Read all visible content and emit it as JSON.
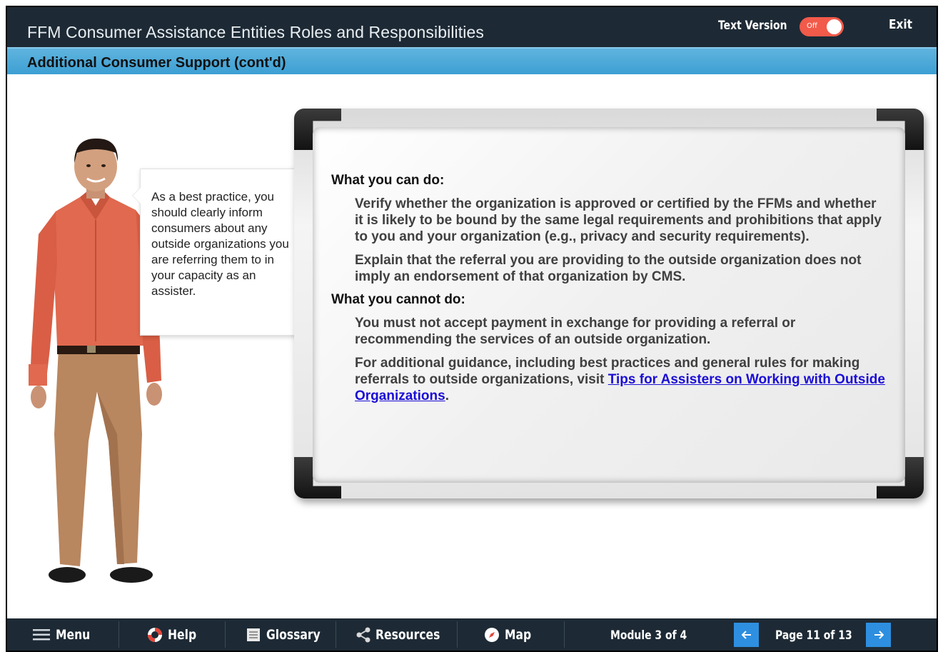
{
  "header": {
    "course_title": "FFM Consumer Assistance Entities Roles and Responsibilities",
    "text_version_label": "Text Version",
    "text_version_toggle": "Off",
    "exit_label": "Exit"
  },
  "subheader": {
    "page_title": "Additional Consumer Support (cont'd)"
  },
  "speech_bubble": {
    "text": "As a best practice, you should clearly inform consumers about any outside organizations you are referring them to in your capacity as an assister."
  },
  "whiteboard": {
    "can_do_heading": "What you can do:",
    "can_do_items": [
      "Verify whether the organization is approved or certified by the FFMs and whether it is likely to be bound by the same legal requirements and prohibitions that apply to you and your organization (e.g., privacy and security requirements).",
      "Explain that the referral you are providing to the outside organization does not imply an endorsement of that organization by CMS."
    ],
    "cannot_do_heading": "What you cannot do:",
    "cannot_do_item": "You must not accept payment in exchange for providing a referral or recommending the services of an outside organization.",
    "guidance_text": "For additional guidance, including best practices and general rules for making referrals to outside organizations, visit ",
    "guidance_link": "Tips for Assisters on Working with Outside Organizations",
    "guidance_end": "."
  },
  "footer": {
    "menu_label": "Menu",
    "help_label": "Help",
    "glossary_label": "Glossary",
    "resources_label": "Resources",
    "map_label": "Map",
    "module_indicator": "Module 3 of 4",
    "page_indicator": "Page 11 of 13"
  },
  "colors": {
    "header_bg": "#1d2a35",
    "subheader_bg": "#4aa8d8",
    "toggle_off": "#f25a4a",
    "arrow_button": "#2e8fe0",
    "link": "#1a0dd6"
  },
  "icons": {
    "menu": "hamburger-icon",
    "help": "lifebuoy-icon",
    "glossary": "book-icon",
    "resources": "share-icon",
    "map": "compass-icon",
    "prev": "arrow-left-icon",
    "next": "arrow-right-icon"
  }
}
